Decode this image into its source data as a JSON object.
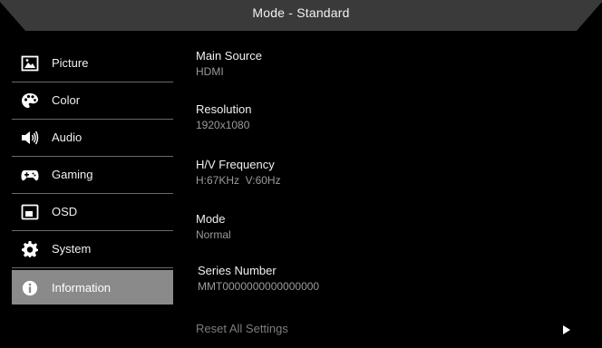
{
  "header": {
    "title": "Mode - Standard"
  },
  "sidebar": {
    "items": [
      {
        "label": "Picture",
        "icon": "picture-icon"
      },
      {
        "label": "Color",
        "icon": "palette-icon"
      },
      {
        "label": "Audio",
        "icon": "speaker-icon"
      },
      {
        "label": "Gaming",
        "icon": "gamepad-icon"
      },
      {
        "label": "OSD",
        "icon": "osd-icon"
      },
      {
        "label": "System",
        "icon": "gear-icon"
      },
      {
        "label": "Information",
        "icon": "info-icon",
        "selected": true
      }
    ]
  },
  "info": {
    "main_source": {
      "label": "Main Source",
      "value": "HDMI"
    },
    "resolution": {
      "label": "Resolution",
      "value": "1920x1080"
    },
    "hv_frequency": {
      "label": "H/V Frequency",
      "value": "H:67KHz  V:60Hz"
    },
    "mode": {
      "label": "Mode",
      "value": "Normal"
    },
    "series_number": {
      "label": "Series Number",
      "value": "MMT0000000000000000"
    }
  },
  "reset": {
    "label": "Reset All Settings"
  },
  "colors": {
    "background": "#000000",
    "header": "#3a3a3a",
    "selected": "#8a8a8a",
    "value_text": "#9a9a9a"
  }
}
